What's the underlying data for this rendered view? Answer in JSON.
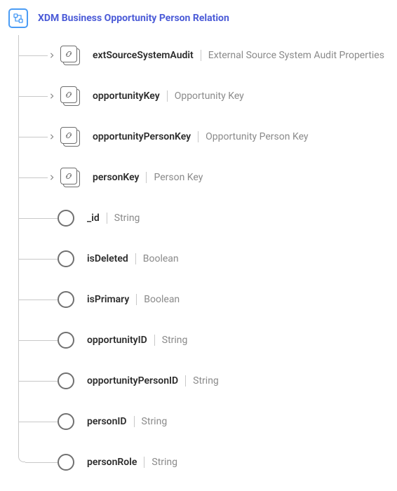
{
  "root": {
    "title": "XDM Business Opportunity Person Relation"
  },
  "fields": [
    {
      "kind": "object",
      "name": "extSourceSystemAudit",
      "type": "External Source System Audit Properties"
    },
    {
      "kind": "object",
      "name": "opportunityKey",
      "type": "Opportunity Key"
    },
    {
      "kind": "object",
      "name": "opportunityPersonKey",
      "type": "Opportunity Person Key"
    },
    {
      "kind": "object",
      "name": "personKey",
      "type": "Person Key"
    },
    {
      "kind": "scalar",
      "name": "_id",
      "type": "String"
    },
    {
      "kind": "scalar",
      "name": "isDeleted",
      "type": "Boolean"
    },
    {
      "kind": "scalar",
      "name": "isPrimary",
      "type": "Boolean"
    },
    {
      "kind": "scalar",
      "name": "opportunityID",
      "type": "String"
    },
    {
      "kind": "scalar",
      "name": "opportunityPersonID",
      "type": "String"
    },
    {
      "kind": "scalar",
      "name": "personID",
      "type": "String"
    },
    {
      "kind": "scalar",
      "name": "personRole",
      "type": "String"
    }
  ]
}
